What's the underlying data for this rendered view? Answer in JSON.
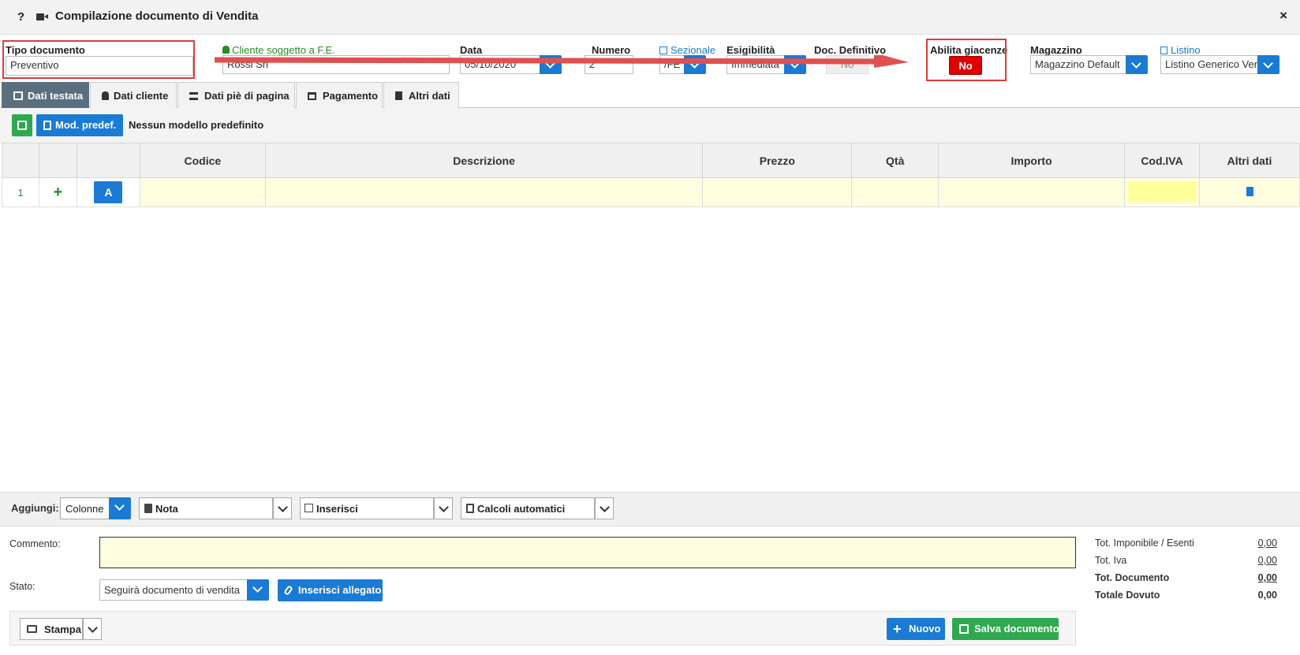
{
  "window": {
    "title": "Compilazione documento di Vendita",
    "help": "?",
    "close": "×"
  },
  "header": {
    "tipo_documento": {
      "label": "Tipo documento",
      "value": "Preventivo"
    },
    "cliente": {
      "label": "Cliente soggetto a F.E.",
      "value": "Rossi Srl"
    },
    "data": {
      "label": "Data",
      "value": "05/10/2020"
    },
    "numero": {
      "label": "Numero",
      "value": "2"
    },
    "sezionale": {
      "label": "Sezionale",
      "value": "/FE"
    },
    "esigibilita": {
      "label": "Esigibilità",
      "value": "Immediata"
    },
    "doc_definitivo": {
      "label": "Doc. Definitivo",
      "value": "No"
    },
    "abilita_giacenze": {
      "label": "Abilita giacenze",
      "value": "No"
    },
    "magazzino": {
      "label": "Magazzino",
      "value": "Magazzino Default"
    },
    "listino": {
      "label": "Listino",
      "value": "Listino Generico Ver"
    }
  },
  "tabs": [
    "Dati testata",
    "Dati cliente",
    "Dati piè di pagina",
    "Pagamento",
    "Altri dati"
  ],
  "toolbar": {
    "mod_predef": "Mod. predef.",
    "nessun_modello": "Nessun modello predefinito"
  },
  "grid": {
    "columns": [
      "Codice",
      "Descrizione",
      "Prezzo",
      "Qtà",
      "Importo",
      "Cod.IVA",
      "Altri dati"
    ],
    "rows": [
      {
        "num": "1",
        "add": "+",
        "btn": "A"
      }
    ]
  },
  "add_bar": {
    "label": "Aggiungi:",
    "colonne": "Colonne",
    "nota": "Nota",
    "inserisci": "Inserisci",
    "calcoli": "Calcoli automatici"
  },
  "bottom": {
    "commento_label": "Commento:",
    "stato_label": "Stato:",
    "stato_value": "Seguirà documento di vendita",
    "inserisci_allegato": "Inserisci allegato"
  },
  "totals": [
    {
      "label": "Tot. Imponibile / Esenti",
      "value": "0,00"
    },
    {
      "label": "Tot. Iva",
      "value": "0,00"
    },
    {
      "label": "Tot. Documento",
      "value": "0,00"
    },
    {
      "label": "Totale Dovuto",
      "value": "0,00"
    }
  ],
  "footer": {
    "stampa": "Stampa",
    "nuovo": "Nuovo",
    "salva": "Salva documento"
  },
  "colors": {
    "primary": "#1a7ad4",
    "success": "#2fa84f",
    "danger": "#e00000",
    "highlight": "#e03a3a"
  }
}
